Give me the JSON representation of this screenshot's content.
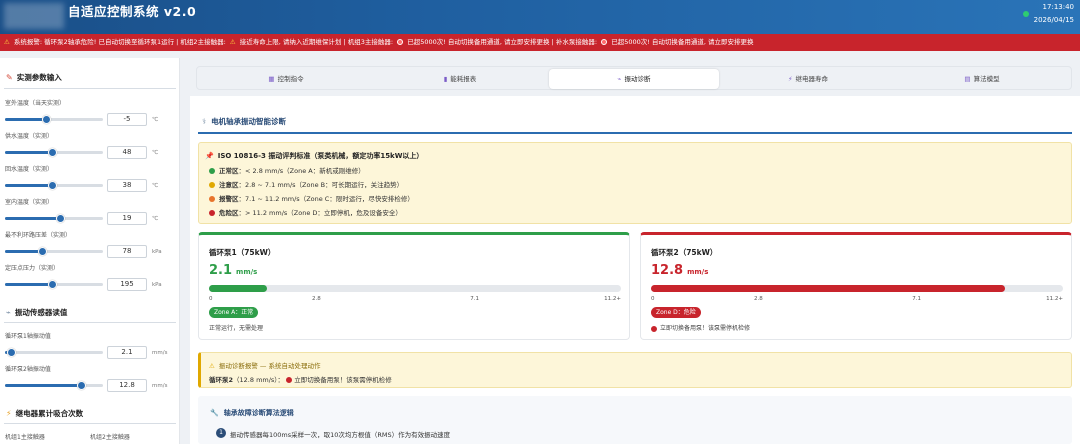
{
  "header": {
    "title": "自适应控制系统 v2.0",
    "time": "17:13:40",
    "date": "2026/04/15"
  },
  "alarm_bar": {
    "segments": [
      "系统报警: 循环泵2轴承危险! 已自动切换至循环泵1运行 | 机组2主接触器:",
      "接近寿命上限, 请纳入近期维保计划 | 机组3主接触器:",
      "已超5000次! 自动切换备用通道, 请立即安排更换 | 补水泵接触器:",
      "已超5000次! 自动切换备用通道, 请立即安排更换"
    ]
  },
  "left_panel": {
    "section1_title": "实测参数输入",
    "params": [
      {
        "label": "室外温度（当天实测）",
        "value": "-5",
        "unit": "℃",
        "fraction": 0.42
      },
      {
        "label": "供水温度（实测）",
        "value": "48",
        "unit": "℃",
        "fraction": 0.48
      },
      {
        "label": "回水温度（实测）",
        "value": "38",
        "unit": "℃",
        "fraction": 0.48
      },
      {
        "label": "室内温度（实测）",
        "value": "19",
        "unit": "℃",
        "fraction": 0.56
      },
      {
        "label": "最不利环路压差（实测）",
        "value": "78",
        "unit": "kPa",
        "fraction": 0.38
      },
      {
        "label": "定压点压力（实测）",
        "value": "195",
        "unit": "kPa",
        "fraction": 0.48
      }
    ],
    "section2_title": "振动传感器读值",
    "sensors": [
      {
        "label": "循环泵1轴振动值",
        "value": "2.1",
        "unit": "mm/s",
        "fraction": 0.06
      },
      {
        "label": "循环泵2轴振动值",
        "value": "12.8",
        "unit": "mm/s",
        "fraction": 0.78
      }
    ],
    "section3_title": "继电器累计吸合次数",
    "relay_labels": [
      "机组1主接触器",
      "机组2主接触器"
    ]
  },
  "tabs": [
    {
      "label": "控制指令",
      "icon": "grid-icon"
    },
    {
      "label": "能耗报表",
      "icon": "bar-chart-icon"
    },
    {
      "label": "振动诊断",
      "icon": "vibration-icon",
      "active": true
    },
    {
      "label": "继电器寿命",
      "icon": "bolt-icon"
    },
    {
      "label": "算法模型",
      "icon": "book-icon"
    }
  ],
  "content": {
    "title": "电机轴承振动智能诊断",
    "iso": {
      "title": "ISO 10816-3 振动评判标准（泵类机械，额定功率15kW以上）",
      "zones": [
        {
          "name": "正常区",
          "desc": "< 2.8 mm/s（Zone A：新机或刚维修）",
          "color": "#2e9e49"
        },
        {
          "name": "注意区",
          "desc": "2.8 ~ 7.1 mm/s（Zone B：可长期运行，关注趋势）",
          "color": "#e0a800"
        },
        {
          "name": "报警区",
          "desc": "7.1 ~ 11.2 mm/s（Zone C：限时运行，尽快安排检修）",
          "color": "#e8742b"
        },
        {
          "name": "危险区",
          "desc": "> 11.2 mm/s（Zone D：立即停机，危及设备安全）",
          "color": "#c8242c"
        }
      ]
    },
    "pumps": [
      {
        "name": "循环泵1（75kW）",
        "value": "2.1",
        "unit": "mm/s",
        "fraction": 0.14,
        "zone": "Zone A：正常",
        "note": "正常运行，无需处理",
        "status": "ok"
      },
      {
        "name": "循环泵2（75kW）",
        "value": "12.8",
        "unit": "mm/s",
        "fraction": 0.86,
        "zone": "Zone D：危险",
        "note": "立即切换备用泵！该泵需停机检修",
        "status": "bad"
      }
    ],
    "ticks": [
      "0",
      "2.8",
      "7.1",
      "11.2+"
    ],
    "alarm": {
      "title": "振动诊断报警 — 系统自动处理动作",
      "pump": "循环泵2",
      "detail": "（12.8 mm/s）：",
      "action": "立即切换备用泵！该泵需停机检修"
    },
    "algo": {
      "title": "轴承故障诊断算法逻辑",
      "step1_num": "1",
      "step1": "振动传感器每100ms采样一次，取10次均方根值（RMS）作为有效振动速度"
    }
  },
  "colors": {
    "ok": "#2e9e49",
    "bad": "#c8242c",
    "accent": "#2b6cb0",
    "header": "#1f5fa0"
  }
}
